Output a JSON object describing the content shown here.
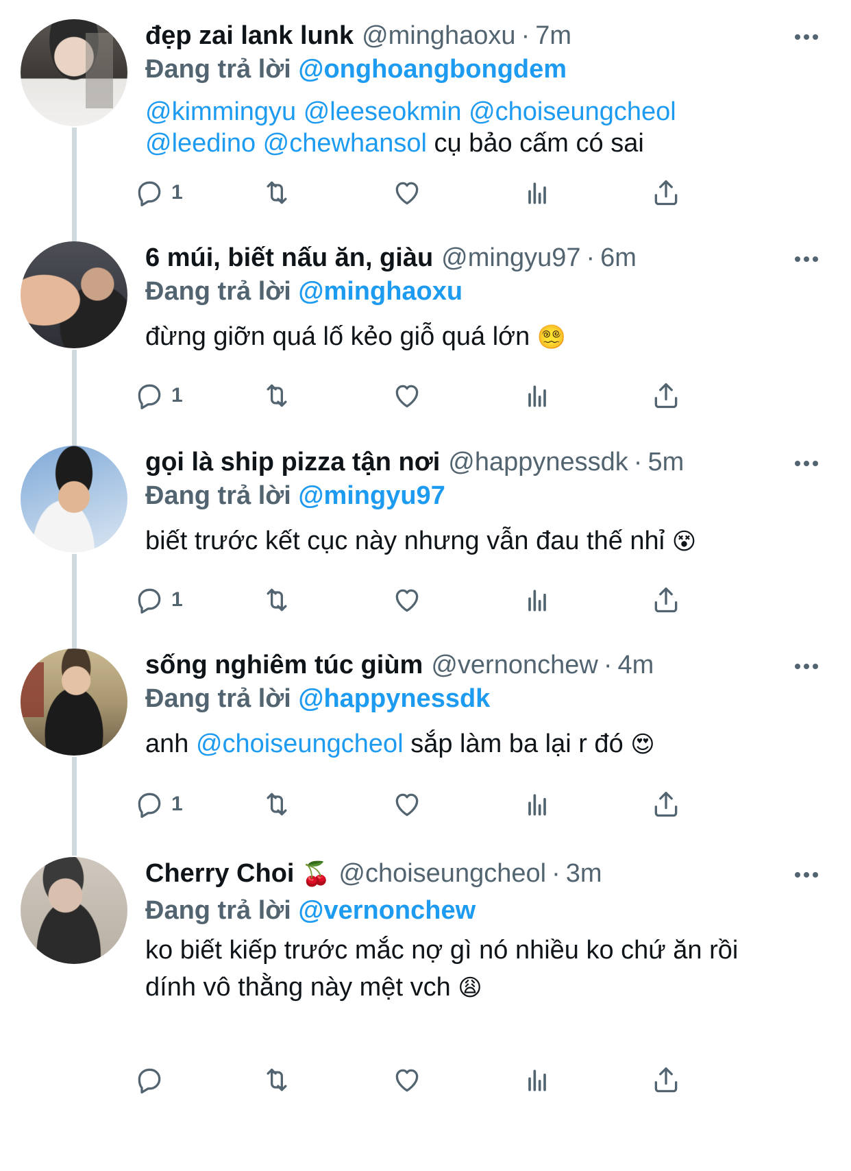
{
  "tweets": [
    {
      "display_name": "đẹp zai lank lunk",
      "handle": "@minghaoxu",
      "time": "7m",
      "reply_prefix": "Đang trả lời",
      "reply_to": "@onghoangbongdem",
      "body_mentions_line1": "@kimmingyu @leeseokmin @choiseungcheol",
      "body_mentions_line2": "@leedino @chewhansol",
      "body_text": "cụ bảo cấm có sai",
      "reply_count": "1"
    },
    {
      "display_name": "6 múi, biết nấu ăn, giàu",
      "handle": "@mingyu97",
      "time": "6m",
      "reply_prefix": "Đang trả lời",
      "reply_to": "@minghaoxu",
      "body_text": "đừng giỡn quá lố kẻo giỗ quá lớn",
      "emoji": "😵‍💫",
      "reply_count": "1"
    },
    {
      "display_name": "gọi là ship pizza tận nơi",
      "handle": "@happynessdk",
      "time": "5m",
      "reply_prefix": "Đang trả lời",
      "reply_to": "@mingyu97",
      "body_text": "biết trước kết cục này nhưng vẫn đau thế nhỉ",
      "emoji": "😵",
      "reply_count": "1"
    },
    {
      "display_name": "sống nghiêm túc giùm",
      "handle": "@vernonchew",
      "time": "4m",
      "reply_prefix": "Đang trả lời",
      "reply_to": "@happynessdk",
      "body_prefix": "anh",
      "body_mention": "@choiseungcheol",
      "body_text": "sắp làm ba lại r đó",
      "emoji": "😍",
      "reply_count": "1"
    },
    {
      "display_name": "Cherry Choi",
      "name_emoji": "🍒",
      "handle": "@choiseungcheol",
      "time": "3m",
      "reply_prefix": "Đang trả lời",
      "reply_to": "@vernonchew",
      "body_line1": "ko biết kiếp trước mắc nợ gì nó nhiều ko chứ ăn rồi",
      "body_line2": "dính vô thằng này mệt vch",
      "emoji": "😩",
      "reply_count": ""
    }
  ],
  "separator_dot": "·",
  "colors": {
    "accent": "#1d9bf0",
    "secondary_text": "#536471",
    "thread_line": "#cfd9de"
  }
}
